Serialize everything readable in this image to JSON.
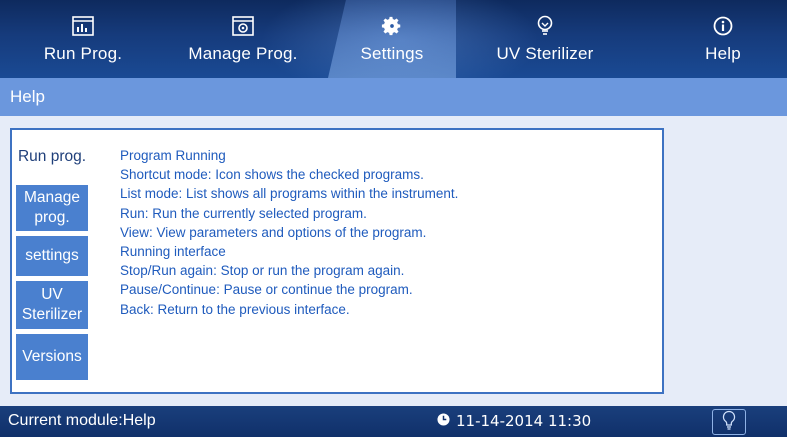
{
  "nav": {
    "items": [
      {
        "id": "run",
        "label": "Run Prog.",
        "icon": "chart-window-icon"
      },
      {
        "id": "manage",
        "label": "Manage Prog.",
        "icon": "program-window-icon"
      },
      {
        "id": "settings",
        "label": "Settings",
        "icon": "gear-icon"
      },
      {
        "id": "uv",
        "label": "UV Sterilizer",
        "icon": "uv-lamp-icon"
      },
      {
        "id": "help",
        "label": "Help",
        "icon": "info-icon"
      }
    ],
    "active": "settings"
  },
  "title": "Help",
  "tabs": [
    {
      "label": "Run prog.",
      "active": true
    },
    {
      "label": "Manage prog.",
      "active": false
    },
    {
      "label": "settings",
      "active": false
    },
    {
      "label": "UV Sterilizer",
      "active": false
    },
    {
      "label": "Versions",
      "active": false
    }
  ],
  "help_lines": [
    "Program Running",
    "Shortcut mode: Icon shows the checked programs.",
    "List mode: List shows all programs within the instrument.",
    "Run: Run the currently selected program.",
    "View: View parameters and options of the program.",
    "Running interface",
    "Stop/Run again: Stop or run the program again.",
    "Pause/Continue: Pause or continue the program.",
    "Back: Return to the previous interface."
  ],
  "status": {
    "module": "Current module:Help",
    "datetime": "11-14-2014 11:30",
    "clock_icon": "clock-icon",
    "bulb_icon": "lightbulb-icon"
  },
  "colors": {
    "nav_bg": "#163b7c",
    "title_bg": "#6b97dd",
    "tab_bg": "#4a80cf",
    "text_blue": "#1f5bbd",
    "panel_border": "#3d72c2"
  }
}
